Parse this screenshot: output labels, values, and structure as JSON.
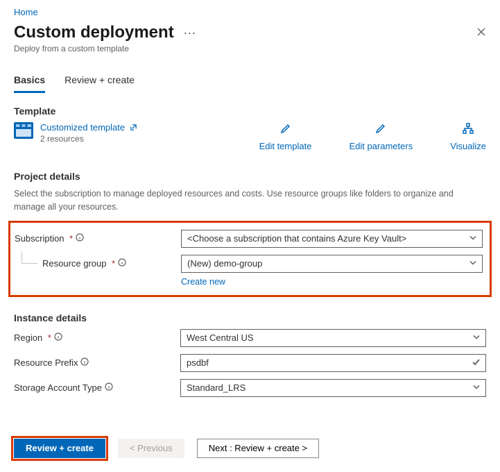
{
  "breadcrumb": {
    "home": "Home"
  },
  "header": {
    "title": "Custom deployment",
    "subtitle": "Deploy from a custom template"
  },
  "tabs": {
    "basics": "Basics",
    "review": "Review + create"
  },
  "template": {
    "section": "Template",
    "name": "Customized template",
    "resources": "2 resources",
    "actions": {
      "edit_template": "Edit template",
      "edit_parameters": "Edit parameters",
      "visualize": "Visualize"
    }
  },
  "project": {
    "section": "Project details",
    "description": "Select the subscription to manage deployed resources and costs. Use resource groups like folders to organize and manage all your resources.",
    "subscription_label": "Subscription",
    "subscription_value": "<Choose a subscription that contains Azure Key Vault>",
    "resource_group_label": "Resource group",
    "resource_group_value": "(New) demo-group",
    "create_new": "Create new"
  },
  "instance": {
    "section": "Instance details",
    "region_label": "Region",
    "region_value": "West Central US",
    "prefix_label": "Resource Prefix",
    "prefix_value": "psdbf",
    "storage_label": "Storage Account Type",
    "storage_value": "Standard_LRS"
  },
  "footer": {
    "review_create": "Review + create",
    "previous": "< Previous",
    "next": "Next : Review + create >"
  }
}
